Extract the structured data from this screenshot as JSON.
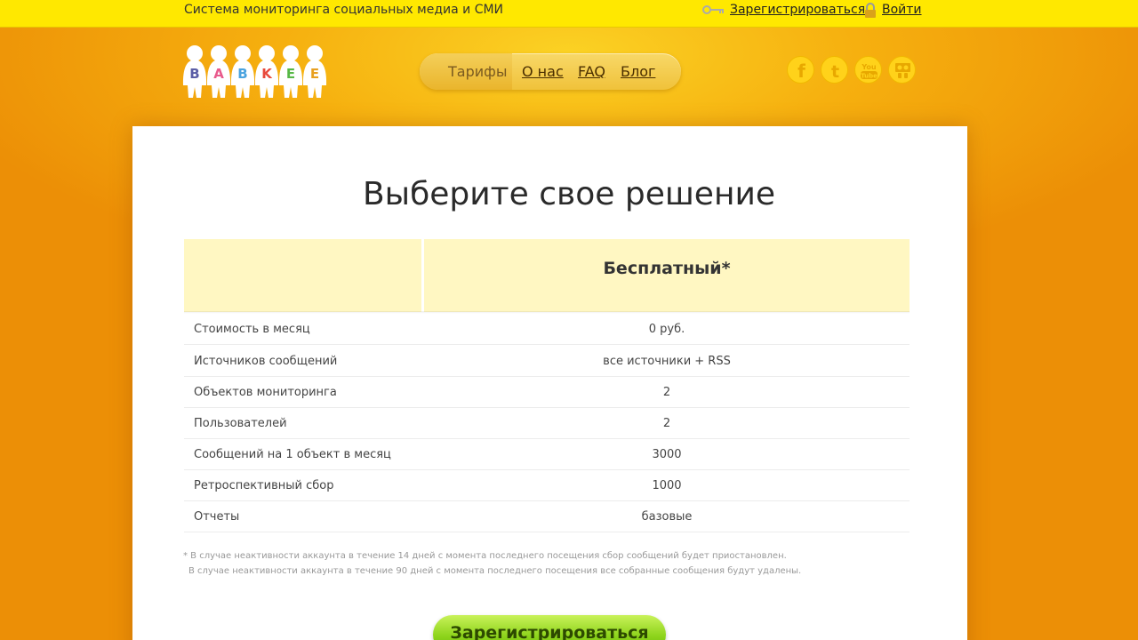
{
  "topbar": {
    "tagline": "Система мониторинга социальных медиа и СМИ",
    "register_label": "Зарегистрироваться",
    "login_label": "Войти"
  },
  "logo": {
    "letters": [
      "B",
      "A",
      "B",
      "K",
      "E",
      "E"
    ],
    "colors": [
      "#5b5ea6",
      "#e85a8c",
      "#4aa3df",
      "#e84a3c",
      "#58b848",
      "#e8a020"
    ]
  },
  "nav": {
    "items": [
      {
        "label": "Тарифы",
        "active": true
      },
      {
        "label": "О нас",
        "active": false
      },
      {
        "label": "FAQ",
        "active": false
      },
      {
        "label": "Блог",
        "active": false
      }
    ]
  },
  "social": [
    "facebook-icon",
    "twitter-icon",
    "youtube-icon",
    "slideshare-icon"
  ],
  "main": {
    "title": "Выберите свое решение",
    "plan_name": "Бесплатный*",
    "rows": [
      {
        "label": "Стоимость в месяц",
        "value": "0 руб."
      },
      {
        "label": "Источников сообщений",
        "value": "все источники + RSS"
      },
      {
        "label": "Объектов мониторинга",
        "value": "2"
      },
      {
        "label": "Пользователей",
        "value": "2"
      },
      {
        "label": "Сообщений на 1 объект в месяц",
        "value": "3000"
      },
      {
        "label": "Ретроспективный сбор",
        "value": "1000"
      },
      {
        "label": "Отчеты",
        "value": "базовые"
      }
    ],
    "note1": "* В случае неактивности аккаунта в течение 14 дней с момента последнего посещения сбор сообщений будет приостановлен.",
    "note2": "В случае неактивности аккаунта в течение 90 дней с момента последнего посещения все собранные сообщения будут удалены.",
    "cta_label": "Зарегистрироваться"
  }
}
